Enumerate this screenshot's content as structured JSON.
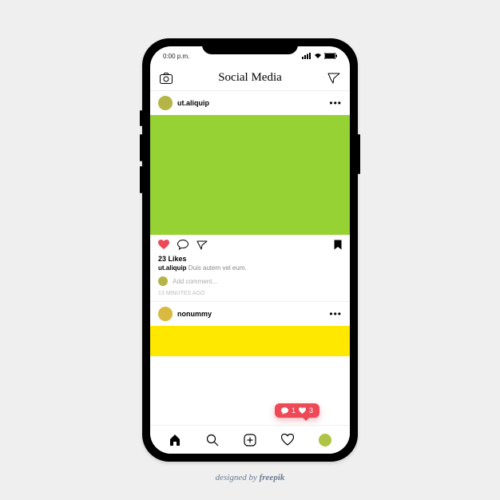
{
  "status": {
    "time": "0:00 p.m."
  },
  "header": {
    "title": "Social Media"
  },
  "post1": {
    "username": "ut.aliquip",
    "likes": "23 Likes",
    "caption_user": "ut.aliquip",
    "caption_text": "Duis autem vel eum.",
    "add_comment": "Add comment...",
    "timestamp": "13 MINUTES AGO",
    "image_color": "#96d233"
  },
  "post2": {
    "username": "nonummy",
    "image_color": "#fee800"
  },
  "notification": {
    "comments": "1",
    "likes": "3"
  },
  "credit": {
    "prefix": "designed by ",
    "brand": "freepik"
  }
}
